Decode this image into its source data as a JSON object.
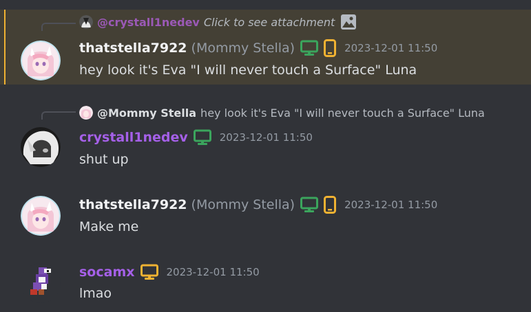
{
  "colors": {
    "background": "#313338",
    "highlight": "#444035",
    "highlight_bar": "#f0b232",
    "role_purple": "#a560e8",
    "desktop_green": "#3ba55d",
    "mobile_yellow": "#f0b232"
  },
  "messages": [
    {
      "reply": {
        "author": "@crystall1nedev",
        "text": "Click to see attachment",
        "icon": "image-icon"
      },
      "author": "thatstella7922",
      "nickname": "(Mommy Stella)",
      "devices": [
        "desktop-icon",
        "mobile-icon"
      ],
      "timestamp": "2023-12-01 11:50",
      "content": "hey look it's Eva \"I will never touch a Surface\" Luna",
      "highlighted": true
    },
    {
      "reply": {
        "author": "@Mommy Stella",
        "text": "hey look it's Eva \"I will never touch a Surface\" Luna"
      },
      "author": "crystall1nedev",
      "devices": [
        "desktop-icon"
      ],
      "timestamp": "2023-12-01 11:50",
      "content": "shut up"
    },
    {
      "author": "thatstella7922",
      "nickname": "(Mommy Stella)",
      "devices": [
        "desktop-icon",
        "mobile-icon"
      ],
      "timestamp": "2023-12-01 11:50",
      "content": "Make me"
    },
    {
      "author": "socamx",
      "devices": [
        "desktop-icon"
      ],
      "timestamp": "2023-12-01 11:50",
      "content": "lmao"
    }
  ]
}
